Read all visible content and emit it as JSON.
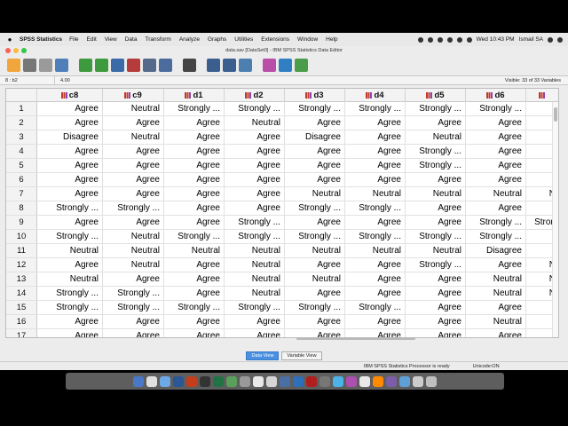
{
  "menubar": {
    "app_name": "SPSS Statistics",
    "items": [
      "File",
      "Edit",
      "View",
      "Data",
      "Transform",
      "Analyze",
      "Graphs",
      "Utilities",
      "Extensions",
      "Window",
      "Help"
    ],
    "clock": "Wed 10:43 PM",
    "user": "Ismail SA"
  },
  "window": {
    "title": "data.sav [DataSet0] - IBM SPSS Statistics Data Editor"
  },
  "cellbar": {
    "ref": "8 : b2",
    "value": "4.00",
    "visible": "Visible: 33 of 33 Variables"
  },
  "grid": {
    "columns": [
      "c8",
      "c9",
      "d1",
      "d2",
      "d3",
      "d4",
      "d5",
      "d6",
      ""
    ],
    "rows": [
      {
        "num": "1",
        "cells": [
          "Agree",
          "Neutral",
          "Strongly ...",
          "Strongly ...",
          "Strongly ...",
          "Strongly ...",
          "Strongly ...",
          "Strongly ...",
          ""
        ]
      },
      {
        "num": "2",
        "cells": [
          "Agree",
          "Agree",
          "Agree",
          "Neutral",
          "Agree",
          "Agree",
          "Agree",
          "Agree",
          ""
        ]
      },
      {
        "num": "3",
        "cells": [
          "Disagree",
          "Neutral",
          "Agree",
          "Agree",
          "Disagree",
          "Agree",
          "Neutral",
          "Agree",
          ""
        ]
      },
      {
        "num": "4",
        "cells": [
          "Agree",
          "Agree",
          "Agree",
          "Agree",
          "Agree",
          "Agree",
          "Strongly ...",
          "Agree",
          ""
        ]
      },
      {
        "num": "5",
        "cells": [
          "Agree",
          "Agree",
          "Agree",
          "Agree",
          "Agree",
          "Agree",
          "Strongly ...",
          "Agree",
          ""
        ]
      },
      {
        "num": "6",
        "cells": [
          "Agree",
          "Agree",
          "Agree",
          "Agree",
          "Agree",
          "Agree",
          "Agree",
          "Agree",
          ""
        ]
      },
      {
        "num": "7",
        "cells": [
          "Agree",
          "Agree",
          "Agree",
          "Agree",
          "Neutral",
          "Neutral",
          "Neutral",
          "Neutral",
          "N"
        ]
      },
      {
        "num": "8",
        "cells": [
          "Strongly ...",
          "Strongly ...",
          "Agree",
          "Agree",
          "Strongly ...",
          "Strongly ...",
          "Agree",
          "Agree",
          ""
        ]
      },
      {
        "num": "9",
        "cells": [
          "Agree",
          "Agree",
          "Agree",
          "Strongly ...",
          "Agree",
          "Agree",
          "Agree",
          "Strongly ...",
          "Stron"
        ]
      },
      {
        "num": "10",
        "cells": [
          "Strongly ...",
          "Neutral",
          "Strongly ...",
          "Strongly ...",
          "Strongly ...",
          "Strongly ...",
          "Strongly ...",
          "Strongly ...",
          ""
        ]
      },
      {
        "num": "11",
        "cells": [
          "Neutral",
          "Neutral",
          "Neutral",
          "Neutral",
          "Neutral",
          "Neutral",
          "Neutral",
          "Disagree",
          ""
        ]
      },
      {
        "num": "12",
        "cells": [
          "Agree",
          "Neutral",
          "Agree",
          "Neutral",
          "Agree",
          "Agree",
          "Strongly ...",
          "Agree",
          "N"
        ]
      },
      {
        "num": "13",
        "cells": [
          "Neutral",
          "Agree",
          "Agree",
          "Neutral",
          "Neutral",
          "Agree",
          "Agree",
          "Neutral",
          "N"
        ]
      },
      {
        "num": "14",
        "cells": [
          "Strongly ...",
          "Strongly ...",
          "Agree",
          "Neutral",
          "Agree",
          "Agree",
          "Agree",
          "Neutral",
          "N"
        ]
      },
      {
        "num": "15",
        "cells": [
          "Strongly ...",
          "Strongly ...",
          "Strongly ...",
          "Strongly ...",
          "Strongly ...",
          "Strongly ...",
          "Agree",
          "Agree",
          ""
        ]
      },
      {
        "num": "16",
        "cells": [
          "Agree",
          "Agree",
          "Agree",
          "Agree",
          "Agree",
          "Agree",
          "Agree",
          "Neutral",
          ""
        ]
      },
      {
        "num": "17",
        "cells": [
          "Agree",
          "Agree",
          "Agree",
          "Agree",
          "Agree",
          "Agree",
          "Agree",
          "Agree",
          ""
        ]
      }
    ]
  },
  "tabs": {
    "data_view": "Data View",
    "variable_view": "Variable View"
  },
  "status": {
    "processor": "IBM SPSS Statistics Processor is ready",
    "unicode": "Unicode:ON"
  },
  "colors": {
    "accent": "#4a90e2",
    "nominal_icon": "#c0392b"
  }
}
